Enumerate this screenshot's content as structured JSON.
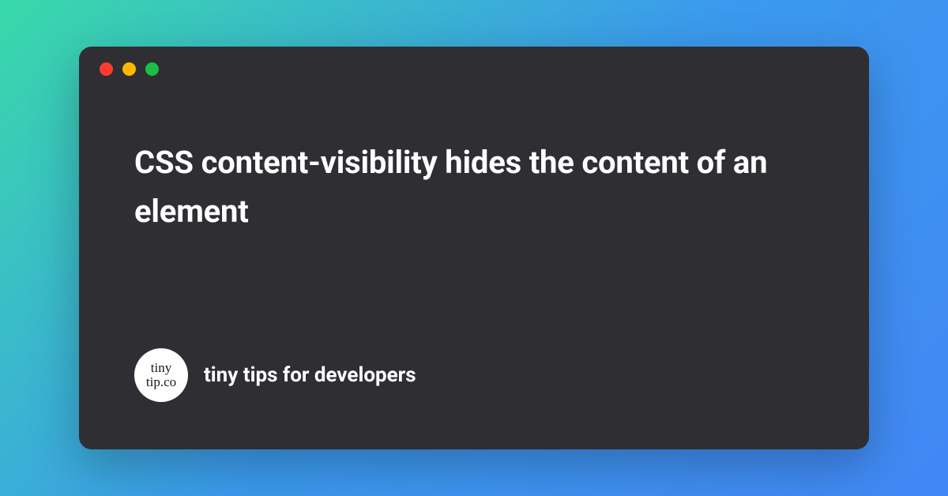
{
  "window": {
    "traffic_lights": {
      "red": "#ff3b30",
      "yellow": "#ffb700",
      "green": "#1bbf44"
    }
  },
  "content": {
    "headline": "CSS content-visibility hides the content of an element"
  },
  "footer": {
    "logo": {
      "line1": "tiny",
      "line2": "tip.co"
    },
    "tagline": "tiny tips for developers"
  }
}
